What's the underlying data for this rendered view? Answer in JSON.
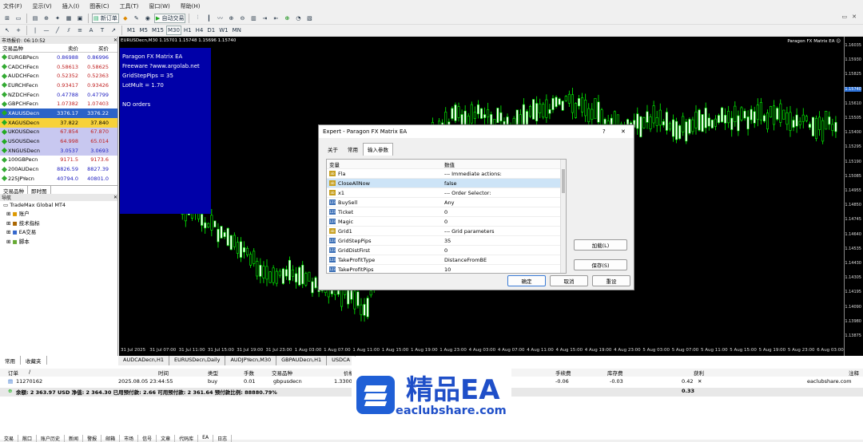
{
  "menu": [
    "文件(F)",
    "显示(V)",
    "插入(I)",
    "图表(C)",
    "工具(T)",
    "窗口(W)",
    "帮助(H)"
  ],
  "toolbar": {
    "new_order": "新订单",
    "auto_trade": "自动交易",
    "timeframes": [
      "M1",
      "M5",
      "M15",
      "M30",
      "H1",
      "H4",
      "D1",
      "W1",
      "MN"
    ]
  },
  "market": {
    "title": "市场报价: 06:10:52",
    "col_symbol": "交易品种",
    "col_bid": "卖价",
    "col_ask": "买价",
    "rows": [
      {
        "s": "EURGBPecn",
        "b": "0.86988",
        "a": "0.86996",
        "bg": "#fff",
        "bc": "#2020c0",
        "ac": "#2020c0"
      },
      {
        "s": "CADCHFecn",
        "b": "0.58613",
        "a": "0.58625",
        "bg": "#fff",
        "bc": "#c02020",
        "ac": "#c02020"
      },
      {
        "s": "AUDCHFecn",
        "b": "0.52352",
        "a": "0.52363",
        "bg": "#fff",
        "bc": "#c02020",
        "ac": "#c02020"
      },
      {
        "s": "EURCHFecn",
        "b": "0.93417",
        "a": "0.93426",
        "bg": "#fff",
        "bc": "#c02020",
        "ac": "#c02020"
      },
      {
        "s": "NZDCHFecn",
        "b": "0.47788",
        "a": "0.47799",
        "bg": "#fff",
        "bc": "#2020c0",
        "ac": "#2020c0"
      },
      {
        "s": "GBPCHFecn",
        "b": "1.07382",
        "a": "1.07403",
        "bg": "#fff",
        "bc": "#c02020",
        "ac": "#c02020"
      },
      {
        "s": "XAUUSDecn",
        "b": "3376.17",
        "a": "3376.22",
        "bg": "#2b63c8",
        "bc": "#fff",
        "ac": "#fff"
      },
      {
        "s": "XAGUSDecn",
        "b": "37.822",
        "a": "37.840",
        "bg": "#f7d23a",
        "bc": "#000",
        "ac": "#000"
      },
      {
        "s": "UKOUSDecn",
        "b": "67.854",
        "a": "67.870",
        "bg": "#c8c8f0",
        "bc": "#c02020",
        "ac": "#c02020"
      },
      {
        "s": "USOUSDecn",
        "b": "64.998",
        "a": "65.014",
        "bg": "#c8c8f0",
        "bc": "#c02020",
        "ac": "#c02020"
      },
      {
        "s": "XNGUSDecn",
        "b": "3.0537",
        "a": "3.0693",
        "bg": "#c8c8f0",
        "bc": "#2020c0",
        "ac": "#2020c0"
      },
      {
        "s": "100GBPecn",
        "b": "9171.5",
        "a": "9173.6",
        "bg": "#fff",
        "bc": "#c02020",
        "ac": "#c02020"
      },
      {
        "s": "200AUDecn",
        "b": "8826.59",
        "a": "8827.39",
        "bg": "#fff",
        "bc": "#2020c0",
        "ac": "#2020c0"
      },
      {
        "s": "225JPYecn",
        "b": "40794.0",
        "a": "40801.0",
        "bg": "#fff",
        "bc": "#2020c0",
        "ac": "#2020c0"
      }
    ],
    "tab1": "交易品种",
    "tab2": "即时图"
  },
  "navigator": {
    "title": "导航",
    "root": "TradeMax Global MT4",
    "items": [
      "账户",
      "技术指标",
      "EA交易",
      "脚本"
    ]
  },
  "chart": {
    "header": "EURUSDecn,M30  1.15701 1.15748 1.15696 1.15740",
    "ea_label": "Paragon FX Matrix EA ☺",
    "info": [
      "Paragon FX Matrix EA",
      "Freeware ?www.argolab.net",
      "GridStepPips = 35",
      "LotMult = 1.70",
      "",
      "NO orders"
    ],
    "yticks": [
      "1.16035",
      "1.15930",
      "1.15825",
      "1.15740",
      "1.15610",
      "1.15505",
      "1.15400",
      "1.15295",
      "1.15190",
      "1.15085",
      "1.14955",
      "1.14850",
      "1.14745",
      "1.14640",
      "1.14535",
      "1.14430",
      "1.14305",
      "1.14195",
      "1.14090",
      "1.13980",
      "1.13875"
    ],
    "xticks": [
      "31 Jul 2025",
      "31 Jul 07:00",
      "31 Jul 11:00",
      "31 Jul 15:00",
      "31 Jul 19:00",
      "31 Jul 23:00",
      "1 Aug 03:00",
      "1 Aug 07:00",
      "1 Aug 11:00",
      "1 Aug 15:00",
      "1 Aug 19:00",
      "1 Aug 23:00",
      "4 Aug 03:00",
      "4 Aug 07:00",
      "4 Aug 11:00",
      "4 Aug 15:00",
      "4 Aug 19:00",
      "4 Aug 23:00",
      "5 Aug 03:00",
      "5 Aug 07:00",
      "5 Aug 11:00",
      "5 Aug 15:00",
      "5 Aug 19:00",
      "5 Aug 23:00",
      "6 Aug 03:00"
    ],
    "tabs": [
      "AUDCADecn,H1",
      "EURUSDecn,Daily",
      "AUDJPYecn,M30",
      "GBPAUDecn,H1",
      "USDCA"
    ]
  },
  "dialog": {
    "title": "Expert - Paragon FX Matrix EA",
    "help": "?",
    "close": "✕",
    "tabs": [
      "关于",
      "常用",
      "输入参数"
    ],
    "col_var": "变量",
    "col_val": "数值",
    "params": [
      {
        "n": "Fla",
        "v": "--- Immediate actions:",
        "t": "ab"
      },
      {
        "n": "CloseAllNow",
        "v": "false",
        "t": "ab",
        "sel": true
      },
      {
        "n": "x1",
        "v": "--- Order Selector:",
        "t": "ab"
      },
      {
        "n": "BuySell",
        "v": "Any",
        "t": "123"
      },
      {
        "n": "Ticket",
        "v": "0",
        "t": "123"
      },
      {
        "n": "Magic",
        "v": "0",
        "t": "123"
      },
      {
        "n": "Grid1",
        "v": "--- Grid parameters",
        "t": "ab"
      },
      {
        "n": "GridStepPips",
        "v": "35",
        "t": "123"
      },
      {
        "n": "GridDistFirst",
        "v": "0",
        "t": "123"
      },
      {
        "n": "TakeProfitType",
        "v": "DistanceFromBE",
        "t": "123"
      },
      {
        "n": "TakeProfitPips",
        "v": "10",
        "t": "123"
      }
    ],
    "load": "加载(L)",
    "save": "保存(S)",
    "ok": "确定",
    "cancel": "取消",
    "reset": "重设"
  },
  "terminal": {
    "left_tabs": [
      "常用",
      "收藏夹"
    ],
    "cols": [
      "订单",
      "/",
      "时间",
      "类型",
      "手数",
      "交易品种",
      "价格",
      "手续费",
      "库存费",
      "获利",
      "注释"
    ],
    "order": {
      "id": "11270162",
      "time": "2025.08.05 23:44:55",
      "type": "buy",
      "lots": "0.01",
      "sym": "gbpusdecn",
      "price": "1.3300",
      "comm": "-0.06",
      "swap": "-0.03",
      "profit": "0.42",
      "comment": "eaclubshare.com",
      "x": "✕"
    },
    "balance": "余额: 2 363.97 USD  净值: 2 364.30  已用预付款: 2.66  可用预付款: 2 361.64  预付款比例: 88880.79%",
    "total": "0.33",
    "bottom_tabs": [
      "交易",
      "敞口",
      "账户历史",
      "新闻",
      "警报",
      "邮箱",
      "市场",
      "信号",
      "文章",
      "代码库",
      "EA",
      "日志"
    ],
    "side": "终端"
  },
  "watermark": {
    "title": "精品EA",
    "url": "eaclubshare.com"
  }
}
